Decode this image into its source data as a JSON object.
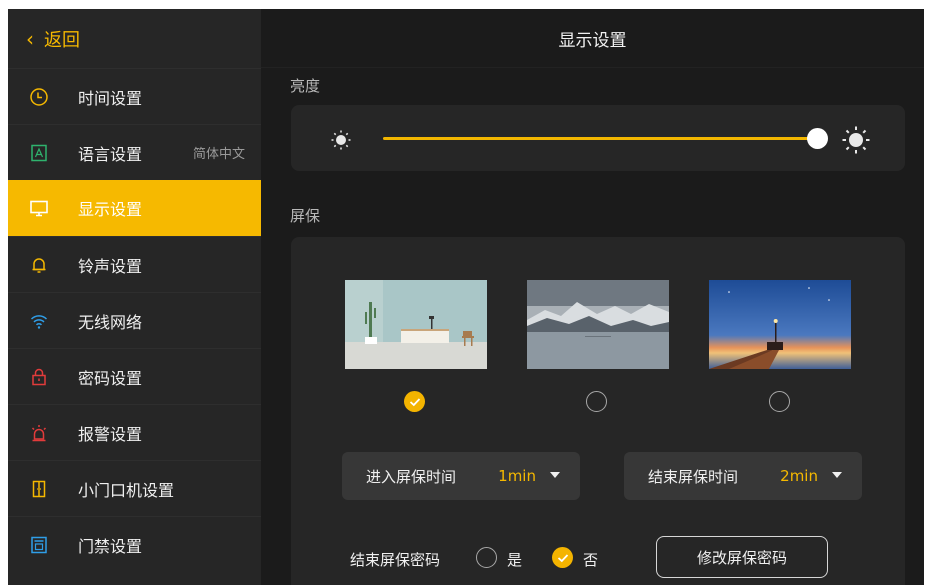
{
  "sidebar": {
    "back_label": "返回",
    "items": [
      {
        "label": "时间设置",
        "icon": "clock-icon",
        "value": ""
      },
      {
        "label": "语言设置",
        "icon": "language-icon",
        "value": "简体中文"
      },
      {
        "label": "显示设置",
        "icon": "monitor-icon",
        "value": ""
      },
      {
        "label": "铃声设置",
        "icon": "bell-icon",
        "value": ""
      },
      {
        "label": "无线网络",
        "icon": "wifi-icon",
        "value": ""
      },
      {
        "label": "密码设置",
        "icon": "lock-icon",
        "value": ""
      },
      {
        "label": "报警设置",
        "icon": "alarm-icon",
        "value": ""
      },
      {
        "label": "小门口机设置",
        "icon": "door-station-icon",
        "value": ""
      },
      {
        "label": "门禁设置",
        "icon": "access-control-icon",
        "value": ""
      }
    ]
  },
  "header": {
    "title": "显示设置"
  },
  "brightness": {
    "label": "亮度",
    "level": 1.0
  },
  "screensaver": {
    "label": "屏保",
    "images": [
      {
        "icon": "living-room-image",
        "selected": true
      },
      {
        "icon": "snowy-mountain-lake-image",
        "selected": false
      },
      {
        "icon": "pier-sunset-image",
        "selected": false
      }
    ],
    "enter_label": "进入屏保时间",
    "enter_value": "1min",
    "exit_label": "结束屏保时间",
    "exit_value": "2min",
    "password_label": "结束屏保密码",
    "option_yes": "是",
    "option_no": "否",
    "password_selected": "否",
    "modify_button": "修改屏保密码"
  },
  "colors": {
    "accent": "#f5b800",
    "background": "#1b1b1b",
    "sidebar": "#262626",
    "panel": "#262626"
  }
}
